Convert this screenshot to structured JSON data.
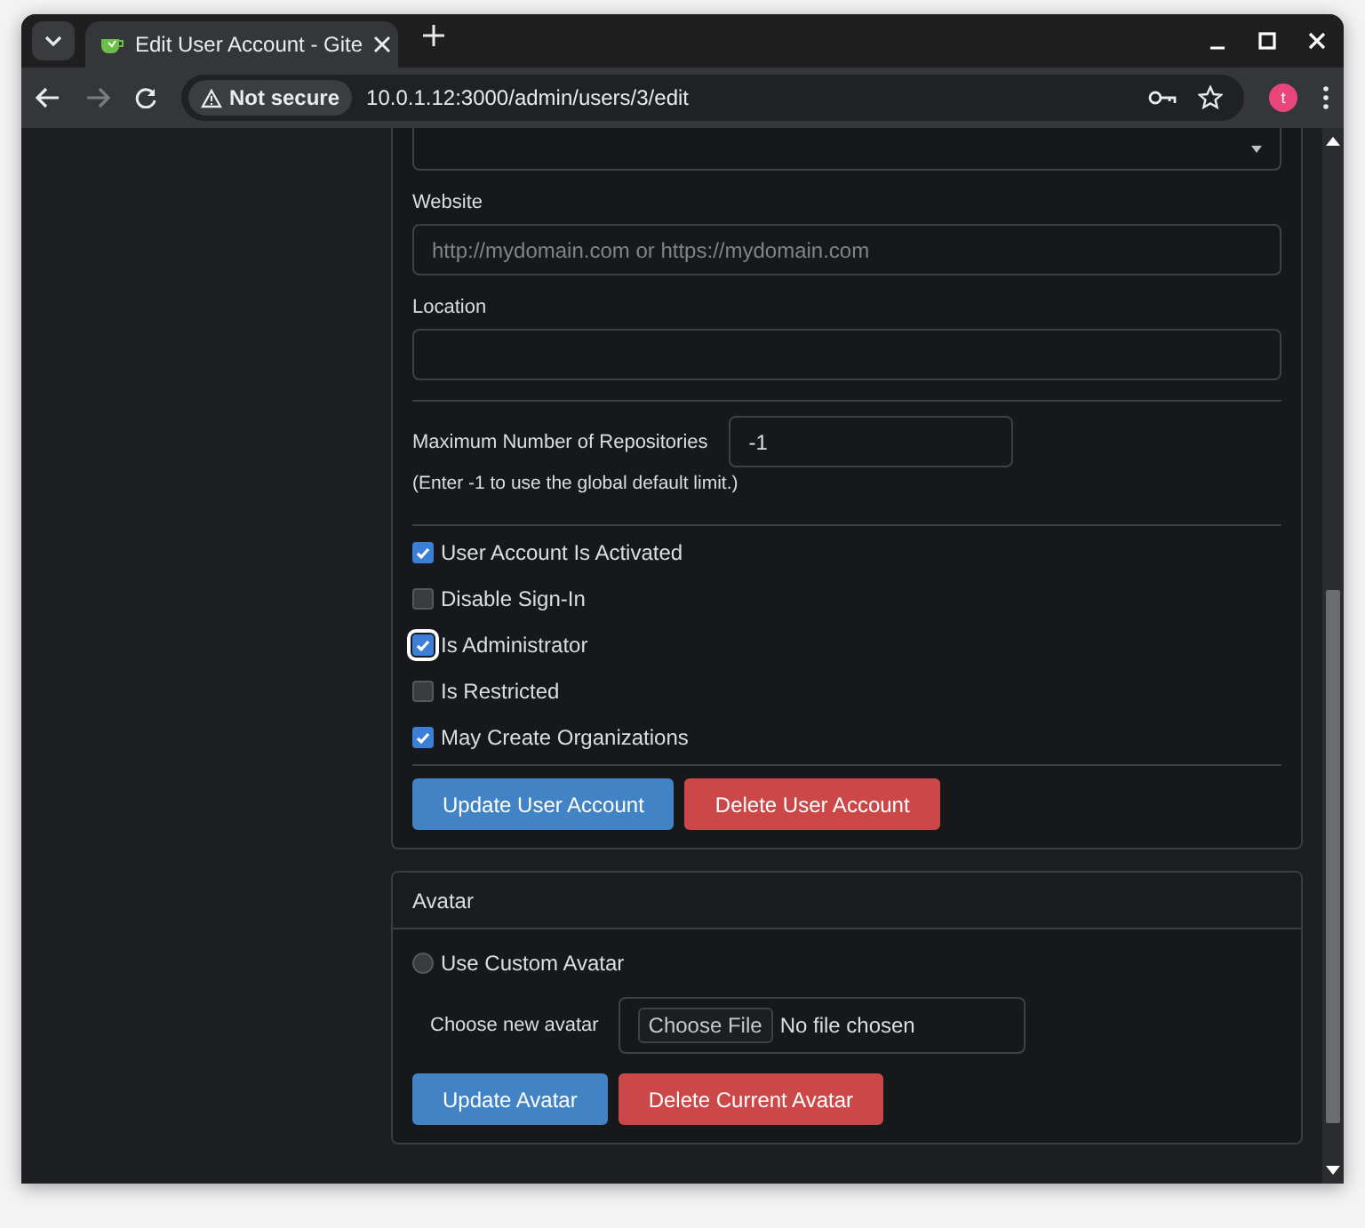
{
  "browser": {
    "tab": {
      "title": "Edit User Account - Gite"
    },
    "toolbar": {
      "back_enabled": true,
      "forward_enabled": false,
      "security": "Not secure",
      "url": "10.0.1.12:3000/admin/users/3/edit",
      "profile_initial": "t"
    }
  },
  "form": {
    "fields": [
      {
        "kind": "select"
      },
      {
        "kind": "text",
        "label": "Website",
        "placeholder": "http://mydomain.com or https://mydomain.com"
      },
      {
        "kind": "text",
        "label": "Location"
      }
    ],
    "max_repos": {
      "label": "Maximum Number of Repositories",
      "value": "-1",
      "hint": "(Enter -1 to use the global default limit.)"
    },
    "checkboxes": [
      {
        "label": "User Account Is Activated",
        "checked": true,
        "focused": false
      },
      {
        "label": "Disable Sign-In",
        "checked": false,
        "focused": false
      },
      {
        "label": "Is Administrator",
        "checked": true,
        "focused": true
      },
      {
        "label": "Is Restricted",
        "checked": false,
        "focused": false
      },
      {
        "label": "May Create Organizations",
        "checked": true,
        "focused": false
      }
    ],
    "buttons": [
      {
        "label": "Update User Account",
        "kind": "primary"
      },
      {
        "label": "Delete User Account",
        "kind": "danger"
      }
    ]
  },
  "avatar": {
    "title": "Avatar",
    "radio": {
      "label": "Use Custom Avatar",
      "checked": false
    },
    "file": {
      "label": "Choose new avatar",
      "button": "Choose File",
      "status": "No file chosen"
    },
    "buttons": [
      {
        "label": "Update Avatar",
        "kind": "primary"
      },
      {
        "label": "Delete Current Avatar",
        "kind": "danger"
      }
    ]
  }
}
